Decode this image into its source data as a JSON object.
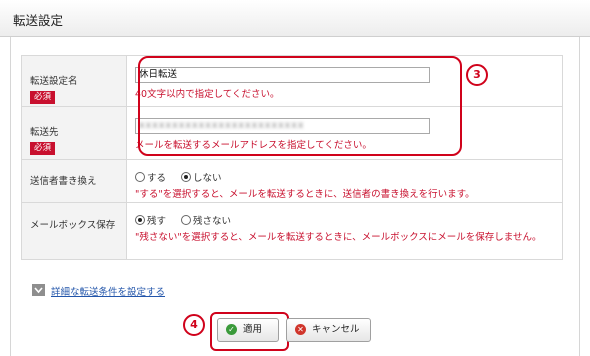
{
  "page": {
    "title": "転送設定"
  },
  "form": {
    "rows": [
      {
        "label": "転送設定名",
        "required": "必須",
        "value": "休日転送",
        "note": "40文字以内で指定してください。"
      },
      {
        "label": "転送先",
        "required": "必須",
        "value": "xxxxxxxxxxxxxxxxxxxxxxxxx",
        "note": "メールを転送するメールアドレスを指定してください。"
      },
      {
        "label": "送信者書き換え",
        "options": [
          "する",
          "しない"
        ],
        "selected": "しない",
        "desc": "\"する\"を選択すると、メールを転送するときに、送信者の書き換えを行います。"
      },
      {
        "label": "メールボックス保存",
        "options": [
          "残す",
          "残さない"
        ],
        "selected": "残す",
        "desc": "\"残さない\"を選択すると、メールを転送するときに、メールボックスにメールを保存しません。"
      }
    ]
  },
  "advanced": {
    "label": "詳細な転送条件を設定する"
  },
  "buttons": {
    "apply": "適用",
    "cancel": "キャンセル"
  },
  "callouts": {
    "c3": "3",
    "c4": "4"
  },
  "colors": {
    "accent_red": "#d0021b",
    "required_badge": "#c8102e",
    "link": "#2255aa"
  }
}
